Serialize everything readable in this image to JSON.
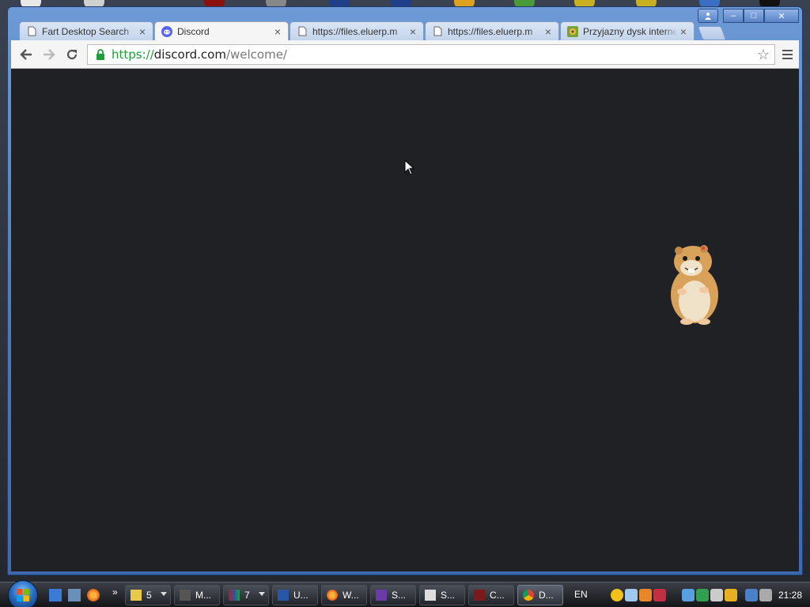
{
  "browser": {
    "tabs": [
      {
        "title": "Fart Desktop Search",
        "icon": "page-icon",
        "active": false
      },
      {
        "title": "Discord",
        "icon": "discord-icon",
        "active": true
      },
      {
        "title": "https://files.eluerp.m",
        "icon": "page-icon",
        "active": false
      },
      {
        "title": "https://files.eluerp.m",
        "icon": "page-icon",
        "active": false
      },
      {
        "title": "Przyjazny dysk interne",
        "icon": "site-favicon-icon",
        "active": false
      }
    ],
    "address": {
      "scheme": "https://",
      "host": "discord.com",
      "path": "/welcome/"
    },
    "page_background": "#202124"
  },
  "taskbar": {
    "quick_launch_more": "»",
    "tasks": [
      {
        "label": "5",
        "icon": "folder-icon",
        "has_arrow": true
      },
      {
        "label": "M...",
        "icon": "app-icon"
      },
      {
        "label": "7",
        "icon": "winrar-icon",
        "has_arrow": true
      },
      {
        "label": "U...",
        "icon": "app-icon"
      },
      {
        "label": "W...",
        "icon": "firefox-icon"
      },
      {
        "label": "S...",
        "icon": "app-icon"
      },
      {
        "label": "S...",
        "icon": "app-icon"
      },
      {
        "label": "C...",
        "icon": "app-icon"
      },
      {
        "label": "D...",
        "icon": "chrome-icon",
        "active": true
      }
    ],
    "language": "EN",
    "clock": "21:28"
  },
  "colors": {
    "secure_green": "#1e9d3a",
    "window_frame": "#4a78bf"
  }
}
